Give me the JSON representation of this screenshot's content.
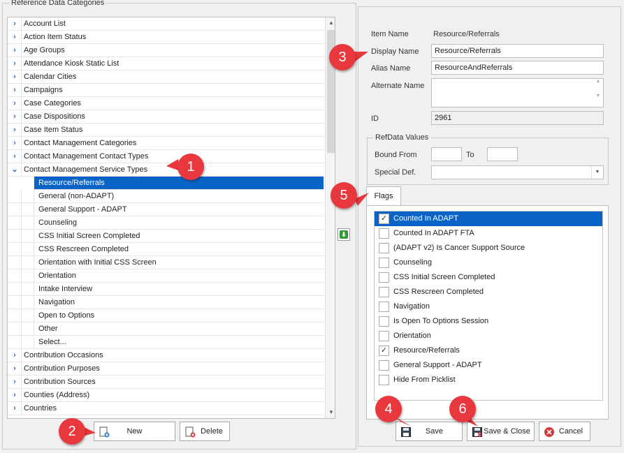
{
  "left_panel": {
    "title": "Reference Data Categories",
    "tree": [
      {
        "label": "Account List",
        "expanded": false
      },
      {
        "label": "Action Item Status",
        "expanded": false
      },
      {
        "label": "Age Groups",
        "expanded": false
      },
      {
        "label": "Attendance Kiosk Static List",
        "expanded": false
      },
      {
        "label": "Calendar Cities",
        "expanded": false
      },
      {
        "label": "Campaigns",
        "expanded": false
      },
      {
        "label": "Case Categories",
        "expanded": false
      },
      {
        "label": "Case Dispositions",
        "expanded": false
      },
      {
        "label": "Case Item Status",
        "expanded": false
      },
      {
        "label": "Contact Management Categories",
        "expanded": false
      },
      {
        "label": "Contact Management Contact Types",
        "expanded": false
      },
      {
        "label": "Contact Management Service Types",
        "expanded": true
      },
      {
        "label": "Resource/Referrals",
        "child": true,
        "selected": true
      },
      {
        "label": "General (non-ADAPT)",
        "child": true
      },
      {
        "label": "General Support - ADAPT",
        "child": true
      },
      {
        "label": "Counseling",
        "child": true
      },
      {
        "label": "CSS Initial Screen Completed",
        "child": true
      },
      {
        "label": "CSS Rescreen Completed",
        "child": true
      },
      {
        "label": "Orientation with Initial CSS Screen",
        "child": true
      },
      {
        "label": "Orientation",
        "child": true
      },
      {
        "label": "Intake Interview",
        "child": true
      },
      {
        "label": "Navigation",
        "child": true
      },
      {
        "label": "Open to Options",
        "child": true
      },
      {
        "label": "Other",
        "child": true
      },
      {
        "label": "Select...",
        "child": true
      },
      {
        "label": "Contribution Occasions",
        "expanded": false
      },
      {
        "label": "Contribution Purposes",
        "expanded": false
      },
      {
        "label": "Contribution Sources",
        "expanded": false
      },
      {
        "label": "Counties (Address)",
        "expanded": false
      },
      {
        "label": "Countries",
        "expanded": false
      }
    ],
    "new_label": "New",
    "delete_label": "Delete"
  },
  "details": {
    "item_name_label": "Item Name",
    "item_name_value": "Resource/Referrals",
    "display_name_label": "Display Name",
    "display_name_value": "Resource/Referrals",
    "alias_name_label": "Alias Name",
    "alias_name_value": "ResourceAndReferrals",
    "alternate_name_label": "Alternate Name",
    "alternate_name_value": "",
    "id_label": "ID",
    "id_value": "2961"
  },
  "refdata": {
    "title": "RefData Values",
    "bound_from_label": "Bound From",
    "bound_from_value": "",
    "to_label": "To",
    "to_value": "",
    "special_def_label": "Special Def.",
    "special_def_value": ""
  },
  "flags": {
    "tab_label": "Flags",
    "items": [
      {
        "label": "Counted In ADAPT",
        "checked": true,
        "selected": true
      },
      {
        "label": "Counted In ADAPT FTA",
        "checked": false
      },
      {
        "label": "(ADAPT v2) Is Cancer Support Source",
        "checked": false
      },
      {
        "label": "Counseling",
        "checked": false
      },
      {
        "label": "CSS Initial Screen Completed",
        "checked": false
      },
      {
        "label": "CSS Rescreen Completed",
        "checked": false
      },
      {
        "label": "Navigation",
        "checked": false
      },
      {
        "label": "Is Open To Options Session",
        "checked": false
      },
      {
        "label": "Orientation",
        "checked": false
      },
      {
        "label": "Resource/Referrals",
        "checked": true
      },
      {
        "label": "General Support - ADAPT",
        "checked": false
      },
      {
        "label": "Hide From Picklist",
        "checked": false
      }
    ]
  },
  "actions": {
    "save_label": "Save",
    "save_close_label": "Save & Close",
    "cancel_label": "Cancel"
  },
  "callouts": [
    "1",
    "2",
    "3",
    "4",
    "5",
    "6"
  ],
  "colors": {
    "selection": "#0a64c8",
    "callout": "#e8383d",
    "tree_arrow": "#1f6fbf"
  }
}
